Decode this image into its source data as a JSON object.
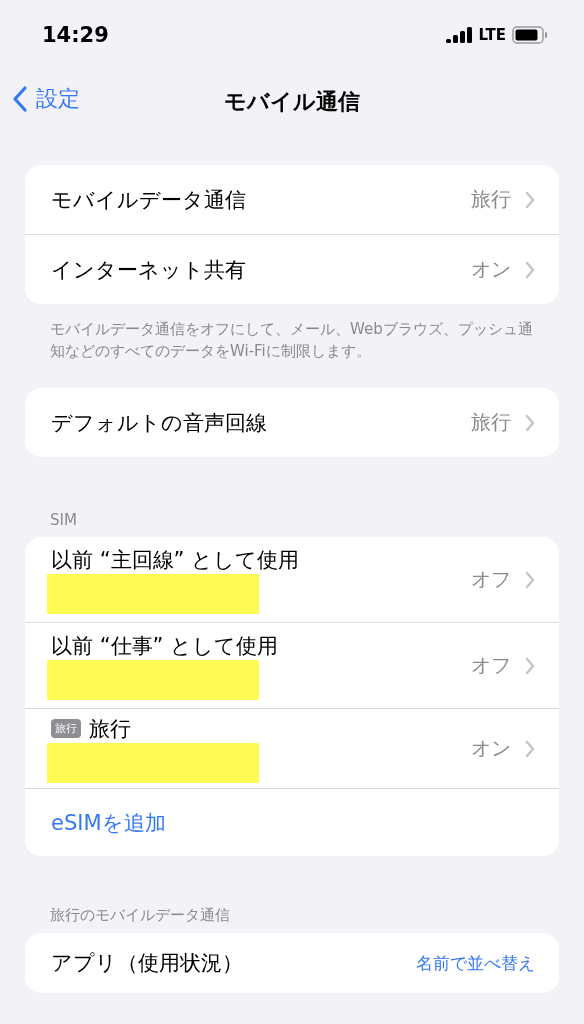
{
  "status_bar": {
    "time": "14:29",
    "network": "LTE"
  },
  "nav": {
    "back": "設定",
    "title": "モバイル通信"
  },
  "group_1": {
    "rows": [
      {
        "label": "モバイルデータ通信",
        "value": "旅行"
      },
      {
        "label": "インターネット共有",
        "value": "オン"
      }
    ],
    "footer": "モバイルデータ通信をオフにして、メール、Webブラウズ、プッシュ通知などのすべてのデータをWi-Fiに制限します。"
  },
  "group_2": {
    "rows": [
      {
        "label": "デフォルトの音声回線",
        "value": "旅行"
      }
    ]
  },
  "sim": {
    "header": "SIM",
    "rows": [
      {
        "label": "以前 “主回線” として使用",
        "value": "オフ",
        "redacted": true
      },
      {
        "label": "以前 “仕事” として使用",
        "value": "オフ",
        "redacted": true
      },
      {
        "badge": "旅行",
        "label": "旅行",
        "value": "オン",
        "redacted": true
      }
    ],
    "add_link": "eSIMを追加"
  },
  "usage": {
    "header": "旅行のモバイルデータ通信",
    "label": "アプリ（使用状況）",
    "sort_link": "名前で並べ替え"
  }
}
